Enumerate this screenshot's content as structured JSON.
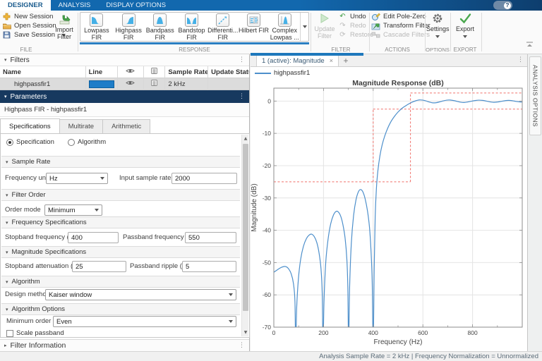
{
  "ribbon": {
    "tabs": [
      {
        "label": "DESIGNER",
        "active": true
      },
      {
        "label": "ANALYSIS",
        "active": false
      },
      {
        "label": "DISPLAY OPTIONS",
        "active": false
      }
    ],
    "help_label": "?",
    "file": {
      "label": "FILE",
      "new_label": "New Session",
      "open_label": "Open Session",
      "save_label": "Save Session",
      "import_line1": "Import",
      "import_line2": "Filter"
    },
    "response": {
      "label": "RESPONSE",
      "buttons": [
        {
          "l1": "Lowpass",
          "l2": "FIR"
        },
        {
          "l1": "Highpass",
          "l2": "FIR"
        },
        {
          "l1": "Bandpass",
          "l2": "FIR"
        },
        {
          "l1": "Bandstop",
          "l2": "FIR"
        },
        {
          "l1": "Differenti...",
          "l2": "FIR"
        },
        {
          "l1": "Hilbert FIR",
          "l2": ""
        },
        {
          "l1": "Complex",
          "l2": "Lowpas ..."
        }
      ]
    },
    "filter": {
      "label": "FILTER",
      "update_line1": "Update",
      "update_line2": "Filter",
      "undo": "Undo",
      "redo": "Redo",
      "restore": "Restore"
    },
    "actions": {
      "label": "ACTIONS",
      "edit_pz": "Edit Pole-Zero",
      "transform": "Transform Filter",
      "cascade": "Cascade Filters"
    },
    "options": {
      "label": "OPTIONS",
      "settings": "Settings"
    },
    "export": {
      "label": "EXPORT",
      "export": "Export"
    }
  },
  "filters_panel": {
    "title": "Filters",
    "col_name": "Name",
    "col_line": "Line",
    "col_sample_rate": "Sample Rate",
    "col_update_status": "Update Status",
    "row": {
      "name": "highpassfir1",
      "line_color": "#1e7dc8",
      "sample_rate": "2 kHz",
      "update_status": ""
    }
  },
  "parameters_panel": {
    "title": "Parameters",
    "subtitle": "Highpass FIR - highpassfir1",
    "tabs": [
      {
        "label": "Specifications",
        "active": true
      },
      {
        "label": "Multirate",
        "active": false
      },
      {
        "label": "Arithmetic",
        "active": false
      }
    ],
    "radio_spec": "Specification",
    "radio_alg": "Algorithm",
    "radio_selected": "Specification",
    "sample_rate": {
      "title": "Sample Rate",
      "freq_units_label": "Frequency units",
      "freq_units_value": "Hz",
      "input_rate_label": "Input sample rate (Hz)",
      "input_rate_value": "2000"
    },
    "filter_order": {
      "title": "Filter Order",
      "order_mode_label": "Order mode",
      "order_mode_value": "Minimum"
    },
    "freq_specs": {
      "title": "Frequency Specifications",
      "stop_label": "Stopband frequency (Hz)",
      "stop_value": "400",
      "pass_label": "Passband frequency (Hz)",
      "pass_value": "550"
    },
    "mag_specs": {
      "title": "Magnitude Specifications",
      "atten_label": "Stopband attenuation (dB)",
      "atten_value": "25",
      "ripple_label": "Passband ripple (dB)",
      "ripple_value": "5"
    },
    "algorithm": {
      "title": "Algorithm",
      "method_label": "Design method",
      "method_value": "Kaiser window"
    },
    "algo_options": {
      "title": "Algorithm Options",
      "min_order_label": "Minimum order",
      "min_order_value": "Even",
      "checkbox_label": "Scale passband",
      "checkbox_checked": false
    },
    "filter_info": {
      "title": "Filter Information"
    }
  },
  "plot_panel": {
    "tab_label": "1 (active): Magnitude",
    "close": "×",
    "new_tab": "+",
    "legend_label": "highpassfir1",
    "legend_color": "#4d8fcb"
  },
  "analysis_options_label": "ANALYSIS OPTIONS",
  "status_bar": "Analysis Sample Rate = 2 kHz | Frequency Normalization = Unnormalized",
  "chart_data": {
    "type": "line",
    "title": "Magnitude Response (dB)",
    "xlabel": "Frequency (Hz)",
    "ylabel": "Magnitude (dB)",
    "xlim": [
      0,
      1000
    ],
    "ylim": [
      -70,
      4
    ],
    "xticks": [
      0,
      200,
      400,
      600,
      800
    ],
    "xminor_step": 100,
    "yticks": [
      -70,
      -60,
      -50,
      -40,
      -30,
      -20,
      -10,
      0
    ],
    "grid": true,
    "legend_position": "top-left-outside",
    "series": [
      {
        "name": "highpassfir1",
        "color": "#4d8fcb",
        "points": [
          [
            0,
            -53
          ],
          [
            15,
            -52.2
          ],
          [
            30,
            -51.5
          ],
          [
            45,
            -51.2
          ],
          [
            58,
            -51.8
          ],
          [
            70,
            -53.5
          ],
          [
            79,
            -56.5
          ],
          [
            85,
            -62
          ],
          [
            88,
            -76
          ],
          [
            92,
            -64
          ],
          [
            99,
            -55
          ],
          [
            108,
            -49
          ],
          [
            119,
            -45
          ],
          [
            131,
            -42.6
          ],
          [
            142,
            -41.5
          ],
          [
            152,
            -41.2
          ],
          [
            163,
            -42
          ],
          [
            173,
            -43.8
          ],
          [
            182,
            -47
          ],
          [
            190,
            -52
          ],
          [
            195,
            -60
          ],
          [
            198,
            -76
          ],
          [
            202,
            -62
          ],
          [
            209,
            -50
          ],
          [
            218,
            -43
          ],
          [
            229,
            -38
          ],
          [
            240,
            -35.3
          ],
          [
            250,
            -34.2
          ],
          [
            259,
            -34.3
          ],
          [
            269,
            -35.6
          ],
          [
            278,
            -38.2
          ],
          [
            287,
            -42.5
          ],
          [
            294,
            -49
          ],
          [
            298,
            -58
          ],
          [
            301,
            -76
          ],
          [
            305,
            -58
          ],
          [
            312,
            -44
          ],
          [
            321,
            -35.5
          ],
          [
            331,
            -30.5
          ],
          [
            341,
            -28
          ],
          [
            350,
            -27.4
          ],
          [
            359,
            -28.2
          ],
          [
            368,
            -30.4
          ],
          [
            377,
            -34
          ],
          [
            385,
            -39
          ],
          [
            391,
            -46
          ],
          [
            396,
            -56
          ],
          [
            400,
            -76
          ],
          [
            404,
            -52
          ],
          [
            408,
            -36
          ],
          [
            413,
            -27
          ],
          [
            419,
            -21.5
          ],
          [
            427,
            -17
          ],
          [
            436,
            -13.6
          ],
          [
            447,
            -10.7
          ],
          [
            459,
            -8.3
          ],
          [
            472,
            -6.3
          ],
          [
            486,
            -4.7
          ],
          [
            500,
            -3.4
          ],
          [
            515,
            -2.3
          ],
          [
            530,
            -1.5
          ],
          [
            545,
            -0.8
          ],
          [
            558,
            -0.3
          ],
          [
            572,
            0.1
          ],
          [
            585,
            0.35
          ],
          [
            598,
            0.3
          ],
          [
            612,
            0.05
          ],
          [
            626,
            -0.3
          ],
          [
            640,
            -0.55
          ],
          [
            654,
            -0.5
          ],
          [
            668,
            -0.25
          ],
          [
            682,
            0.05
          ],
          [
            696,
            0.28
          ],
          [
            710,
            0.32
          ],
          [
            724,
            0.15
          ],
          [
            738,
            -0.1
          ],
          [
            752,
            -0.35
          ],
          [
            766,
            -0.45
          ],
          [
            780,
            -0.3
          ],
          [
            795,
            -0.05
          ],
          [
            810,
            0.15
          ],
          [
            825,
            0.28
          ],
          [
            840,
            0.2
          ],
          [
            855,
            0
          ],
          [
            870,
            -0.25
          ],
          [
            885,
            -0.4
          ],
          [
            900,
            -0.3
          ],
          [
            915,
            -0.1
          ],
          [
            930,
            0.1
          ],
          [
            945,
            0.2
          ],
          [
            960,
            0.1
          ],
          [
            975,
            -0.1
          ],
          [
            990,
            -0.25
          ],
          [
            1000,
            -0.3
          ]
        ]
      }
    ],
    "mask": {
      "color": "#f0706a",
      "dash": "3,2.5",
      "segments": [
        [
          [
            0,
            -25
          ],
          [
            550,
            -25
          ]
        ],
        [
          [
            400,
            -25
          ],
          [
            400,
            -2.5
          ]
        ],
        [
          [
            550,
            -25
          ],
          [
            550,
            2.5
          ]
        ],
        [
          [
            400,
            -2.5
          ],
          [
            1000,
            -2.5
          ]
        ],
        [
          [
            550,
            2.5
          ],
          [
            1000,
            2.5
          ]
        ]
      ]
    }
  }
}
